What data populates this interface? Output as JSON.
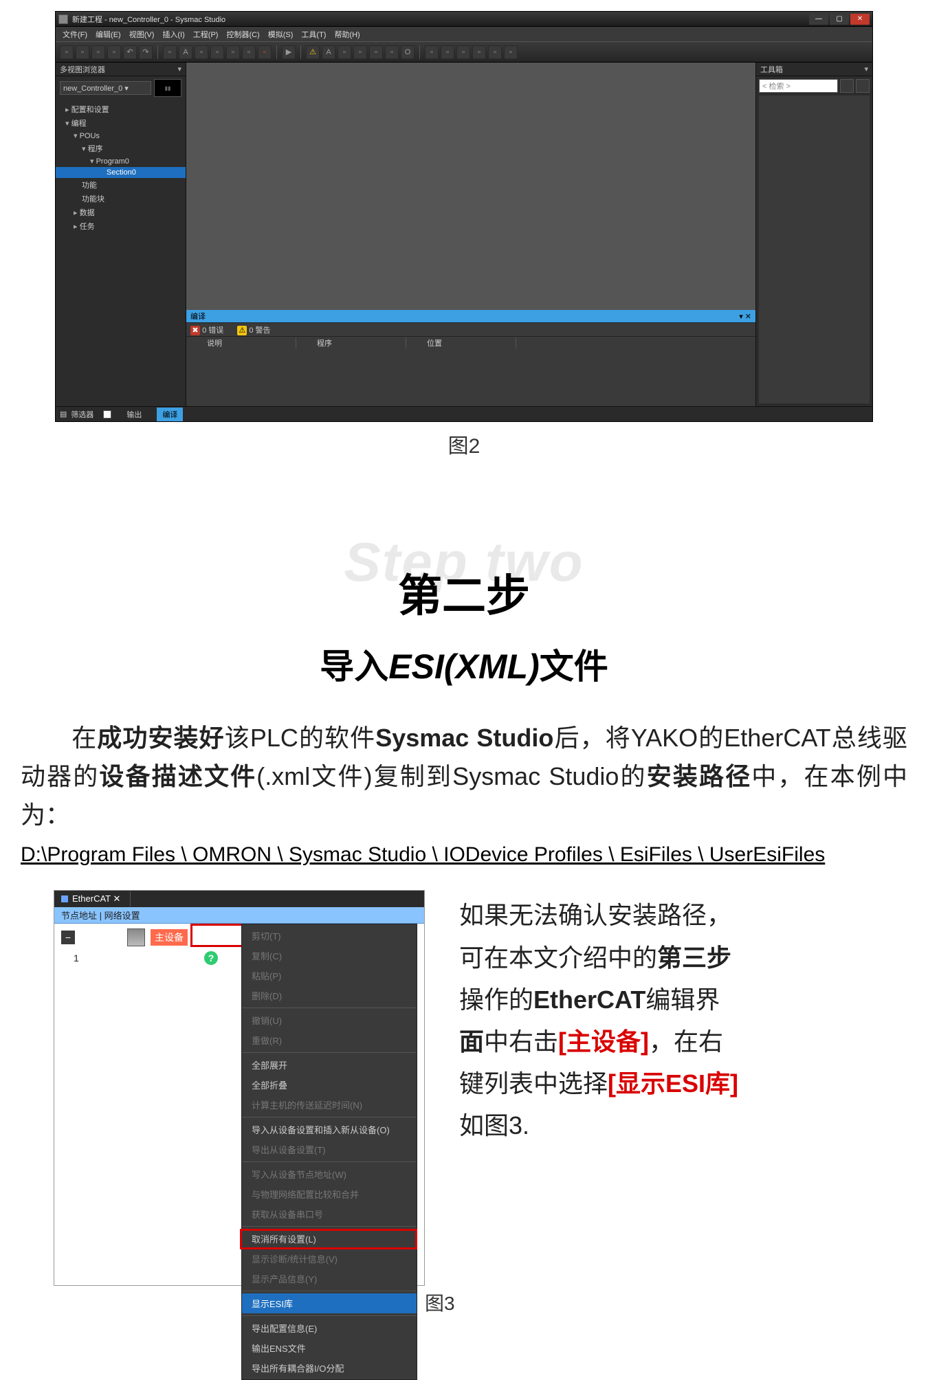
{
  "app": {
    "title": "新建工程 - new_Controller_0 - Sysmac Studio",
    "menus": [
      "文件(F)",
      "编辑(E)",
      "视图(V)",
      "插入(I)",
      "工程(P)",
      "控制器(C)",
      "模拟(S)",
      "工具(T)",
      "帮助(H)"
    ],
    "winbtns": {
      "min": "—",
      "max": "▢",
      "close": "✕"
    }
  },
  "left_panel": {
    "title": "多视图浏览器",
    "controller_combo": "new_Controller_0 ▾",
    "tree": {
      "config": "配置和设置",
      "prog_root": "编程",
      "pous": "POUs",
      "programs": "程序",
      "program0": "Program0",
      "section0": "Section0",
      "func": "功能",
      "funcblk": "功能块",
      "data": "数据",
      "task": "任务"
    }
  },
  "output_panel": {
    "title": "编译",
    "pin": "▾ ✕",
    "err_lbl": "0 错误",
    "warn_lbl": "0 警告",
    "cols": [
      "说明",
      "程序",
      "位置"
    ]
  },
  "right_panel": {
    "title": "工具箱",
    "search_placeholder": "< 检索 >"
  },
  "statusbar": {
    "filter": "筛选器",
    "tab_out": "输出",
    "tab_compile": "编译"
  },
  "fig2_caption": "图2",
  "step": {
    "ghost": "Step two",
    "zh": "第二步",
    "sub_pre": "导入",
    "sub_em": "ESI(XML)",
    "sub_post": "文件"
  },
  "para": {
    "t1": "在",
    "b1": "成功安装好",
    "t2": "该PLC的软件",
    "b2": "Sysmac Studio",
    "t3": "后，将YAKO的EtherCAT总线驱动器的",
    "b3": "设备描述文件",
    "t4": "(.xml文件)复制到Sysmac Studio的",
    "b4": "安装路径",
    "t5": "中，在本例中为："
  },
  "path": "D:\\Program Files \\ OMRON \\ Sysmac Studio \\ IODevice Profiles \\ EsiFiles \\ UserEsiFiles",
  "ecat": {
    "tab": "EtherCAT ✕",
    "head": "节点地址 | 网络设置",
    "master": "主设备",
    "row1_num": "1",
    "ctx": {
      "cut": "剪切(T)",
      "copy": "复制(C)",
      "paste": "粘贴(P)",
      "del": "删除(D)",
      "undo": "撤销(U)",
      "redo": "重做(R)",
      "expand": "全部展开",
      "collapse": "全部折叠",
      "calc": "计算主机的传送延迟时间(N)",
      "import_slave": "导入从设备设置和插入新从设备(O)",
      "export_slave": "导出从设备设置(T)",
      "write_node": "写入从设备节点地址(W)",
      "compare": "与物理网络配置比较和合并",
      "get_serial": "获取从设备串口号",
      "cancel_all": "取消所有设置(L)",
      "diag": "显示诊断/统计信息(V)",
      "prod": "显示产品信息(Y)",
      "esi": "显示ESI库",
      "export_cfg": "导出配置信息(E)",
      "ens": "输出ENS文件",
      "io": "导出所有耦合器I/O分配"
    }
  },
  "fig3_right": {
    "l1": "如果无法确认安装路径，",
    "l2a": "可在本文介绍中的",
    "l2b": "第三步",
    "l3a": "操作的",
    "l3b": "EtherCAT",
    "l3c": "编辑界",
    "l4a": "面",
    "l4b": "中右击",
    "l4c": "[主设备]",
    "l4d": "，在右",
    "l5a": "键列表中选择",
    "l5b": "[显示ESI库]",
    "l6": "如图3."
  },
  "fig3_caption": "图3"
}
